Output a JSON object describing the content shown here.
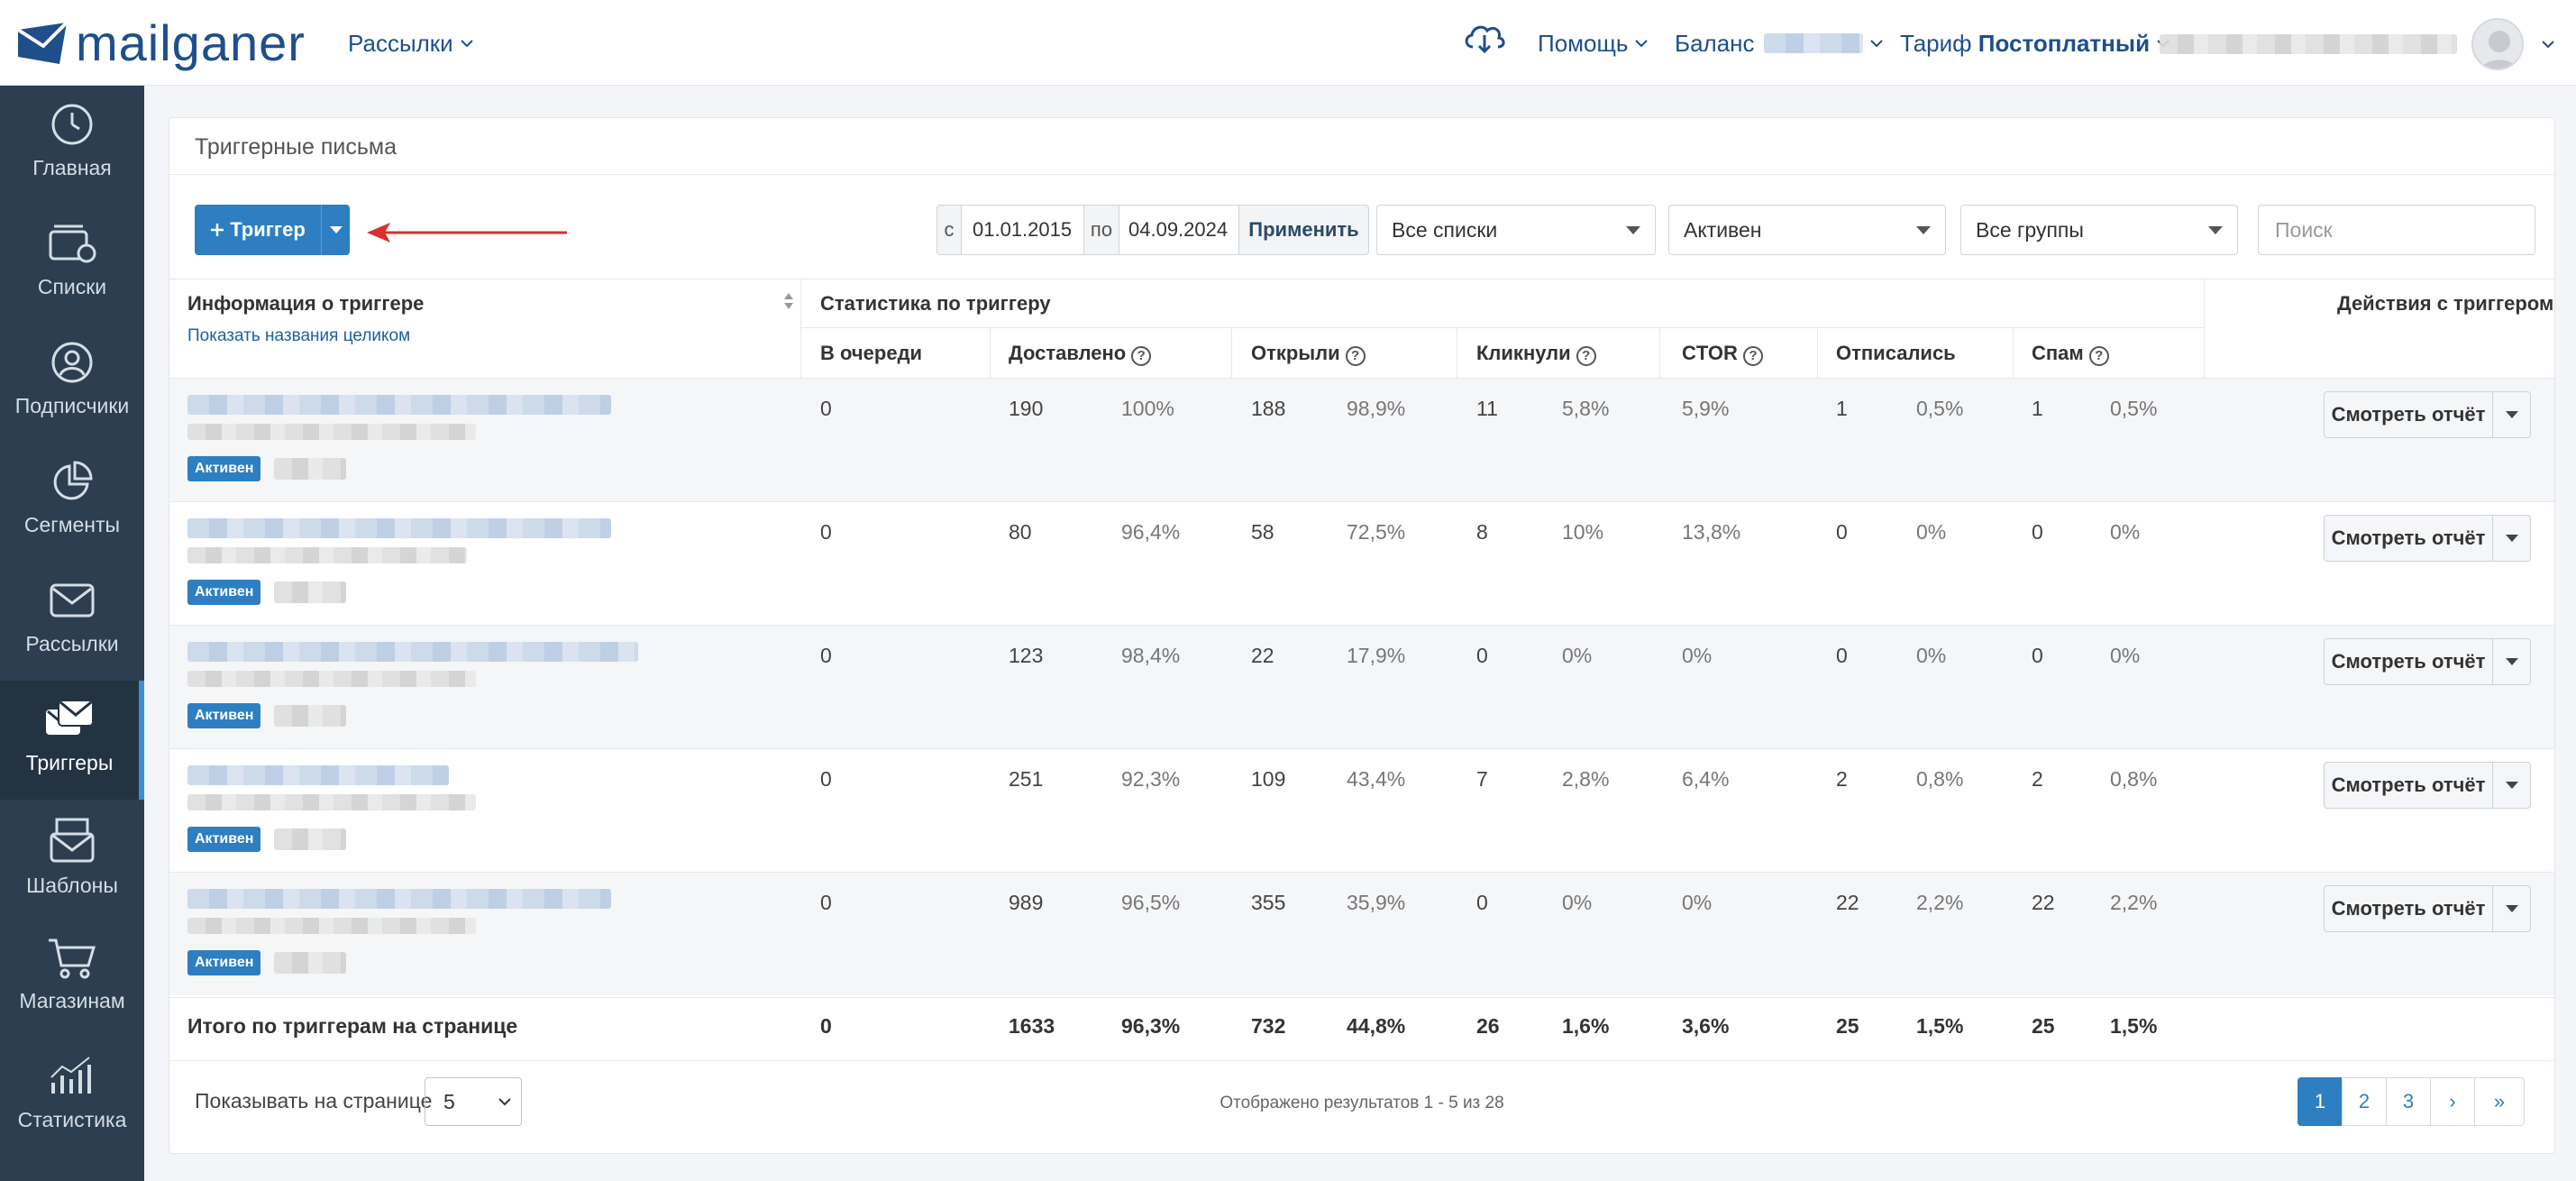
{
  "brand": {
    "name": "mailganer",
    "color": "#1e4f8b"
  },
  "topnav": {
    "mailings_label": "Рассылки",
    "help_label": "Помощь",
    "balance_label": "Баланс",
    "tariff_prefix": "Тариф",
    "tariff_value": "Постоплатный"
  },
  "sidebar": {
    "items": [
      {
        "label": "Главная",
        "icon": "dashboard-icon"
      },
      {
        "label": "Списки",
        "icon": "lists-icon"
      },
      {
        "label": "Подписчики",
        "icon": "user-icon"
      },
      {
        "label": "Сегменты",
        "icon": "pie-chart-icon"
      },
      {
        "label": "Рассылки",
        "icon": "envelope-icon"
      },
      {
        "label": "Триггеры",
        "icon": "triggers-icon",
        "active": true
      },
      {
        "label": "Шаблоны",
        "icon": "template-icon"
      },
      {
        "label": "Магазинам",
        "icon": "cart-icon"
      },
      {
        "label": "Статистика",
        "icon": "stats-icon"
      }
    ]
  },
  "panel": {
    "title": "Триггерные письма"
  },
  "toolbar": {
    "add_trigger_label": "Триггер",
    "date_from_prefix": "с",
    "date_from": "01.01.2015",
    "date_to_prefix": "по",
    "date_to": "04.09.2024",
    "apply_label": "Применить",
    "lists_select": "Все списки",
    "status_select": "Активен",
    "groups_select": "Все группы",
    "search_placeholder": "Поиск"
  },
  "table": {
    "info_header": "Информация о триггере",
    "show_names_link": "Показать названия целиком",
    "stats_header": "Статистика по триггеру",
    "actions_header": "Действия с триггером",
    "columns": {
      "queued": "В очереди",
      "delivered": "Доставлено",
      "opened": "Открыли",
      "clicked": "Кликнули",
      "ctor": "CTOR",
      "unsubscribed": "Отписались",
      "spam": "Спам"
    },
    "status_badge": "Активен",
    "report_button": "Смотреть отчёт",
    "rows": [
      {
        "queued": "0",
        "delivered": "190",
        "delivered_pct": "100%",
        "opened": "188",
        "opened_pct": "98,9%",
        "clicked": "11",
        "clicked_pct": "5,8%",
        "ctor": "5,9%",
        "unsub": "1",
        "unsub_pct": "0,5%",
        "spam": "1",
        "spam_pct": "0,5%"
      },
      {
        "queued": "0",
        "delivered": "80",
        "delivered_pct": "96,4%",
        "opened": "58",
        "opened_pct": "72,5%",
        "clicked": "8",
        "clicked_pct": "10%",
        "ctor": "13,8%",
        "unsub": "0",
        "unsub_pct": "0%",
        "spam": "0",
        "spam_pct": "0%"
      },
      {
        "queued": "0",
        "delivered": "123",
        "delivered_pct": "98,4%",
        "opened": "22",
        "opened_pct": "17,9%",
        "clicked": "0",
        "clicked_pct": "0%",
        "ctor": "0%",
        "unsub": "0",
        "unsub_pct": "0%",
        "spam": "0",
        "spam_pct": "0%"
      },
      {
        "queued": "0",
        "delivered": "251",
        "delivered_pct": "92,3%",
        "opened": "109",
        "opened_pct": "43,4%",
        "clicked": "7",
        "clicked_pct": "2,8%",
        "ctor": "6,4%",
        "unsub": "2",
        "unsub_pct": "0,8%",
        "spam": "2",
        "spam_pct": "0,8%"
      },
      {
        "queued": "0",
        "delivered": "989",
        "delivered_pct": "96,5%",
        "opened": "355",
        "opened_pct": "35,9%",
        "clicked": "0",
        "clicked_pct": "0%",
        "ctor": "0%",
        "unsub": "22",
        "unsub_pct": "2,2%",
        "spam": "22",
        "spam_pct": "2,2%"
      }
    ],
    "totals": {
      "label": "Итого по триггерам на странице",
      "queued": "0",
      "delivered": "1633",
      "delivered_pct": "96,3%",
      "opened": "732",
      "opened_pct": "44,8%",
      "clicked": "26",
      "clicked_pct": "1,6%",
      "ctor": "3,6%",
      "unsub": "25",
      "unsub_pct": "1,5%",
      "spam": "25",
      "spam_pct": "1,5%"
    }
  },
  "footer": {
    "per_page_label": "Показывать на странице",
    "per_page_value": "5",
    "results_text": "Отображено результатов 1 - 5 из 28",
    "pages": [
      "1",
      "2",
      "3"
    ],
    "next_label": "›",
    "last_label": "»"
  },
  "colors": {
    "accent": "#2d7fc1",
    "sidebar_bg": "#2c3e50",
    "arrow": "#d9302c"
  }
}
